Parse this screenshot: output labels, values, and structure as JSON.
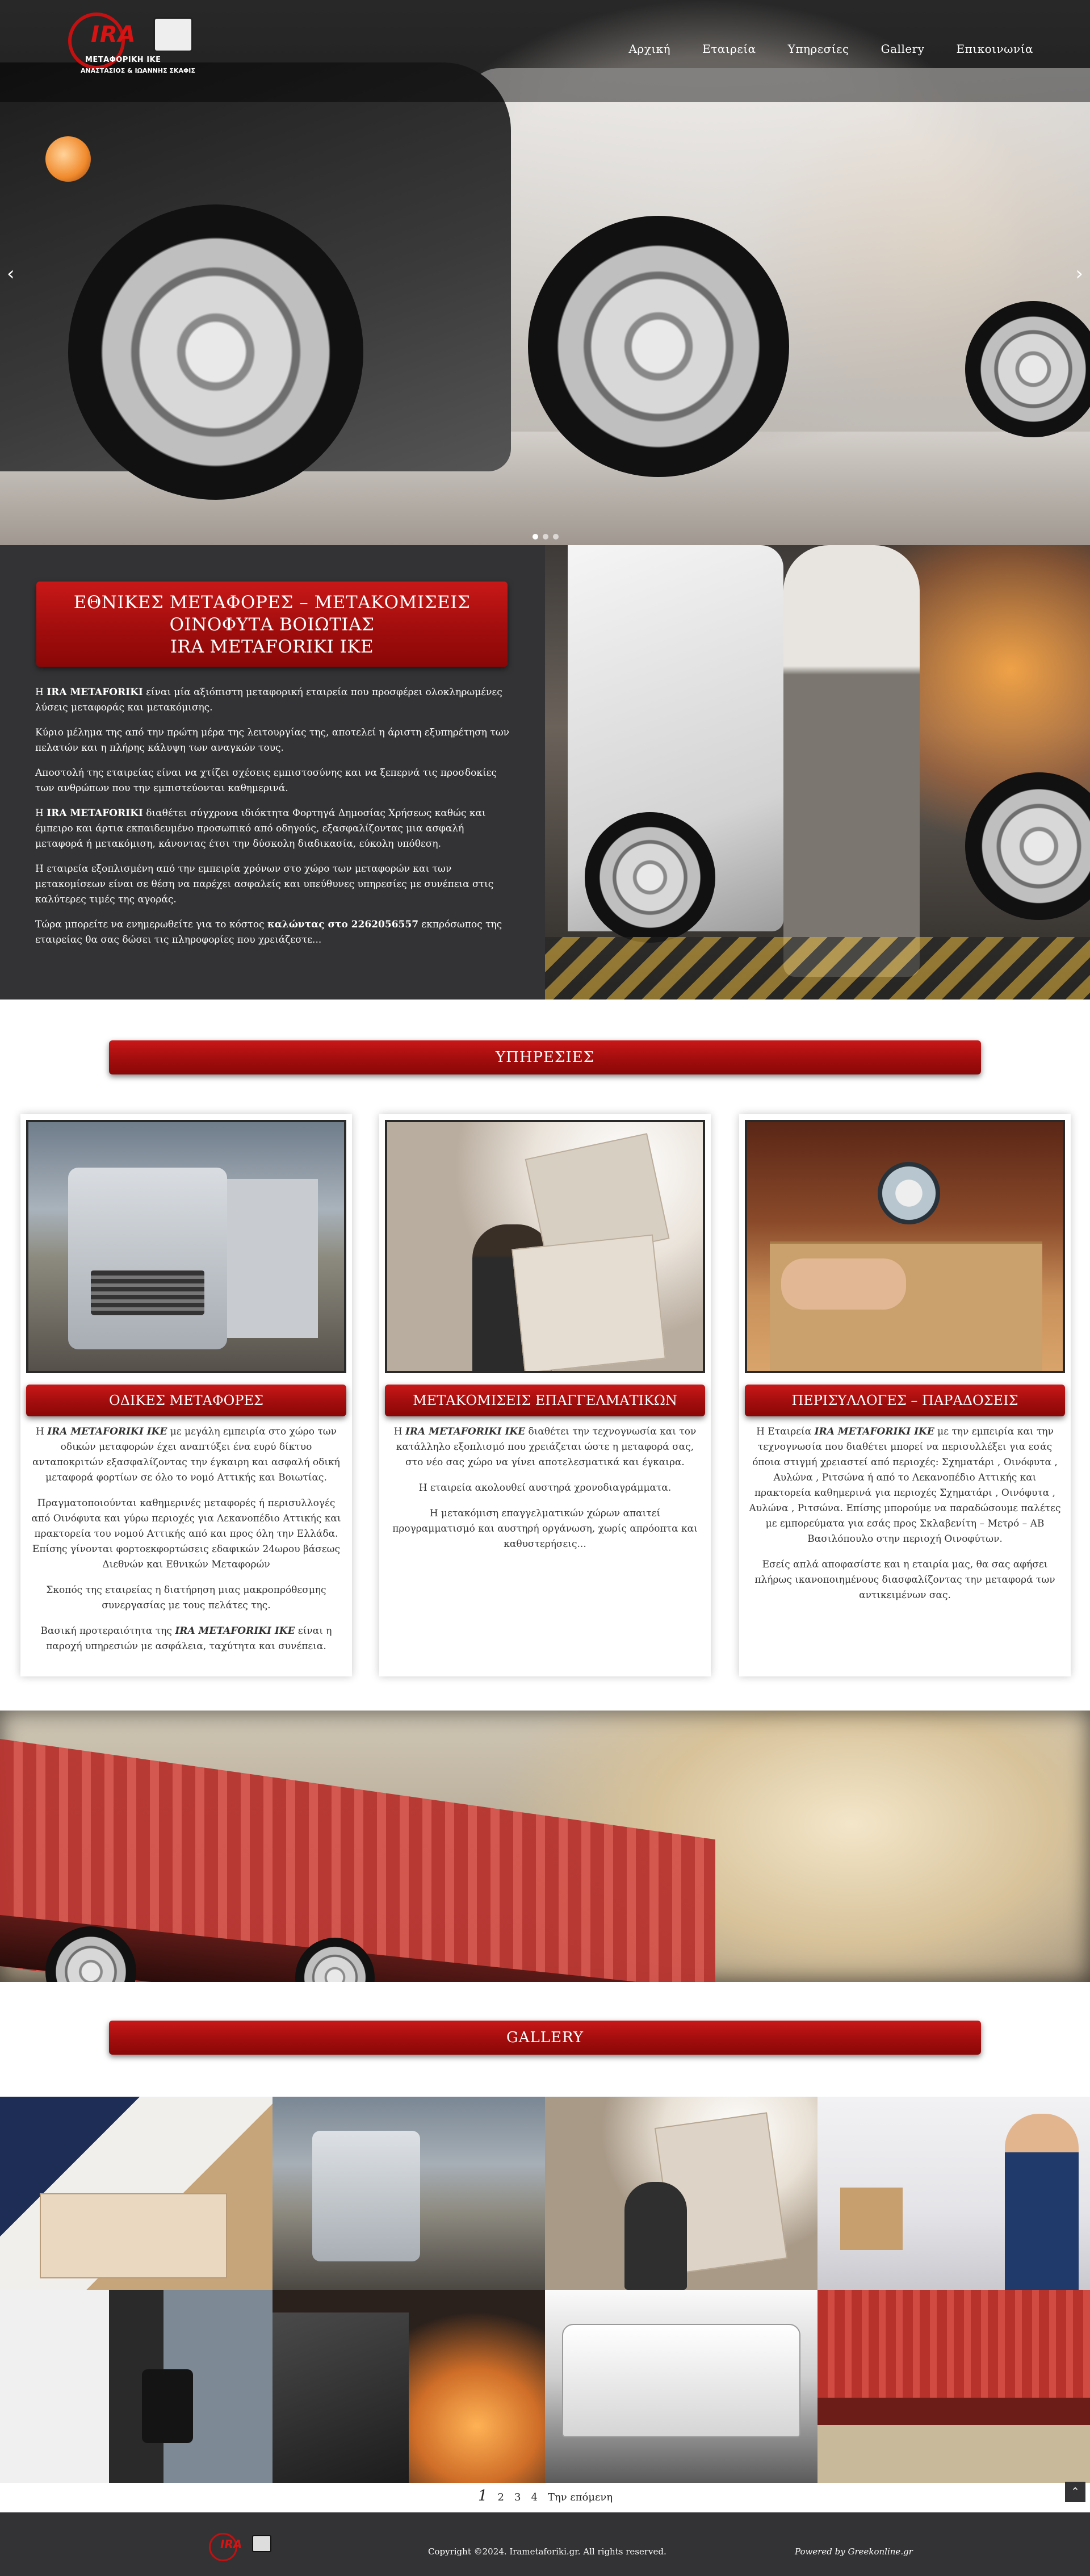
{
  "logo": {
    "brand": "IRA",
    "line1": "ΜΕΤΑΦΟΡΙΚΗ ΙΚΕ",
    "line2": "ΑΝΑΣΤΑΣΙΟΣ & ΙΩΑΝΝΗΣ ΣΚΑΦΙΣ"
  },
  "nav": {
    "items": [
      "Αρχική",
      "Εταιρεία",
      "Υπηρεσίες",
      "Gallery",
      "Επικοινωνία"
    ]
  },
  "slider": {
    "prev_icon": "chevron-left-icon",
    "next_icon": "chevron-right-icon",
    "prev_glyph": "‹",
    "next_glyph": "›",
    "dots": 3,
    "active_dot": 1
  },
  "about": {
    "title_line1": "ΕΘΝΙΚΕΣ ΜΕΤΑΦΟΡΕΣ – ΜΕΤΑΚΟΜΙΣΕΙΣ",
    "title_line2": "ΟΙΝΟΦΥΤΑ ΒΟΙΩΤΙΑΣ",
    "title_line3": "IRA METAFORIKI IKE",
    "p1_pre": "Η ",
    "p1_bold": "IRA METAFORIKI",
    "p1_post": " είναι μία αξιόπιστη μεταφορική εταιρεία που προσφέρει ολοκληρωμένες λύσεις μεταφοράς και μετακόμισης.",
    "p2": "Κύριο μέλημα της από την πρώτη μέρα της λειτουργίας της, αποτελεί η άριστη εξυπηρέτηση των πελατών και η πλήρης κάλυψη των αναγκών τους.",
    "p3": "Αποστολή της εταιρείας είναι να χτίζει σχέσεις εμπιστοσύνης και να ξεπερνά τις προσδοκίες των ανθρώπων που την εμπιστεύονται καθημερινά.",
    "p4_pre": "Η ",
    "p4_bold": "IRA METAFORIKI",
    "p4_post": " διαθέτει σύγχρονα ιδιόκτητα Φορτηγά Δημοσίας Χρήσεως καθώς και έμπειρο και άρτια εκπαιδευμένο προσωπικό από οδηγούς, εξασφαλίζοντας μια ασφαλή μεταφορά ή μετακόμιση, κάνοντας έτσι την δύσκολη διαδικασία, εύκολη υπόθεση.",
    "p5": "Η εταιρεία εξοπλισμένη από την εμπειρία χρόνων στο χώρο των μεταφορών και των μετακομίσεων είναι σε θέση να παρέχει ασφαλείς και υπεύθυνες υπηρεσίες με συνέπεια στις καλύτερες τιμές της αγοράς.",
    "p6_pre": "Τώρα μπορείτε να ενημερωθείτε για το κόστος ",
    "p6_bold": "καλώντας στο 2262056557",
    "p6_post": " εκπρόσωπος της εταιρείας θα σας δώσει τις πληροφορίες που χρειάζεστε..."
  },
  "services": {
    "title": "ΥΠΗΡΕΣΙΕΣ",
    "cards": [
      {
        "label": "ΟΔΙΚΕΣ ΜΕΤΑΦΟΡΕΣ",
        "p1_pre": "Η  ",
        "p1_bold": "IRA METAFORIKI IKE",
        "p1_post": " με μεγάλη εμπειρία στο χώρο των οδικών μεταφορών έχει αναπτύξει ένα ευρύ δίκτυο ανταποκριτών εξασφαλίζοντας την έγκαιρη και ασφαλή οδική μεταφορά φορτίων σε όλο το νομό Αττικής και Βοιωτίας.",
        "p2": "Πραγματοποιούνται καθημερινές μεταφορές ή περισυλλογές από Οινόφυτα και γύρω περιοχές για Λεκανοπέδιο Αττικής και πρακτορεία του νομού Αττικής από και προς όλη την Ελλάδα. Επίσης γίνονται φορτοεκφορτώσεις εδαφικών 24ωρου βάσεως Διεθνών και Εθνικών Μεταφορών",
        "p3": "Σκοπός της εταιρείας η διατήρηση μιας μακροπρόθεσμης συνεργασίας με τους πελάτες της.",
        "p4_pre": "Βασική προτεραιότητα της ",
        "p4_bold": "IRA METAFORIKI IKE",
        "p4_post": " είναι η παροχή υπηρεσιών με ασφάλεια, ταχύτητα και συνέπεια."
      },
      {
        "label": "ΜΕΤΑΚΟΜΙΣΕΙΣ ΕΠΑΓΓΕΛΜΑΤΙΚΩΝ ΧΩΡΩΝ",
        "p1_pre": "Η  ",
        "p1_bold": "IRA METAFORIKI IKE",
        "p1_post": " διαθέτει την τεχνογνωσία και τον κατάλληλο εξοπλισμό που χρειάζεται ώστε η μεταφορά σας, στο νέο σας  χώρο να γίνει αποτελεσματικά και έγκαιρα.",
        "p2": "Η εταιρεία ακολουθεί αυστηρά χρονοδιαγράμματα.",
        "p3": "Η μετακόμιση επαγγελματικών  χώρων απαιτεί προγραμματισμό και αυστηρή οργάνωση, χωρίς απρόοπτα και καθυστερήσεις..."
      },
      {
        "label": "ΠΕΡΙΣΥΛΛΟΓΕΣ – ΠΑΡΑΔΟΣΕΙΣ",
        "p1_pre": "Η Εταιρεία ",
        "p1_bold": "IRA METAFORIKI IKE",
        "p1_post": " με την εμπειρία και την τεχνογνωσία που διαθέτει μπορεί να περισυλλέξει για εσάς όποια στιγμή χρειαστεί από περιοχές: Σχηματάρι , Οινόφυτα , Αυλώνα , Ριτσώνα ή από το Λεκανοπέδιο Αττικής και πρακτορεία καθημερινά για περιοχές Σχηματάρι , Οινόφυτα , Αυλώνα , Ριτσώνα. Επίσης μπορούμε να παραδώσουμε παλέτες με εμπορεύματα για εσάς προς Σκλαβενίτη – Μετρό – ΑΒ Βασιλόπουλο στην περιοχή Οινοφύτων.",
        "p2": "Εσείς απλά αποφασίστε και η εταιρία μας, θα σας αφήσει πλήρως ικανοποιημένους διασφαλίζοντας την μεταφορά των αντικειμένων σας."
      }
    ]
  },
  "gallery": {
    "title": "GALLERY",
    "images": 8
  },
  "pagination": {
    "current": "1",
    "pages": [
      "2",
      "3",
      "4"
    ],
    "next": "Την επόμενη"
  },
  "footer": {
    "brand": "IRA",
    "copyright": "Copyright ©2024. Irametaforiki.gr. All rights reserved.",
    "powered": "Powered by Greekonline.gr",
    "back_to_top_icon": "chevron-up-icon",
    "back_to_top_glyph": "⌃"
  },
  "colors": {
    "accent_red": "#b01212",
    "dark_panel": "#333335"
  }
}
